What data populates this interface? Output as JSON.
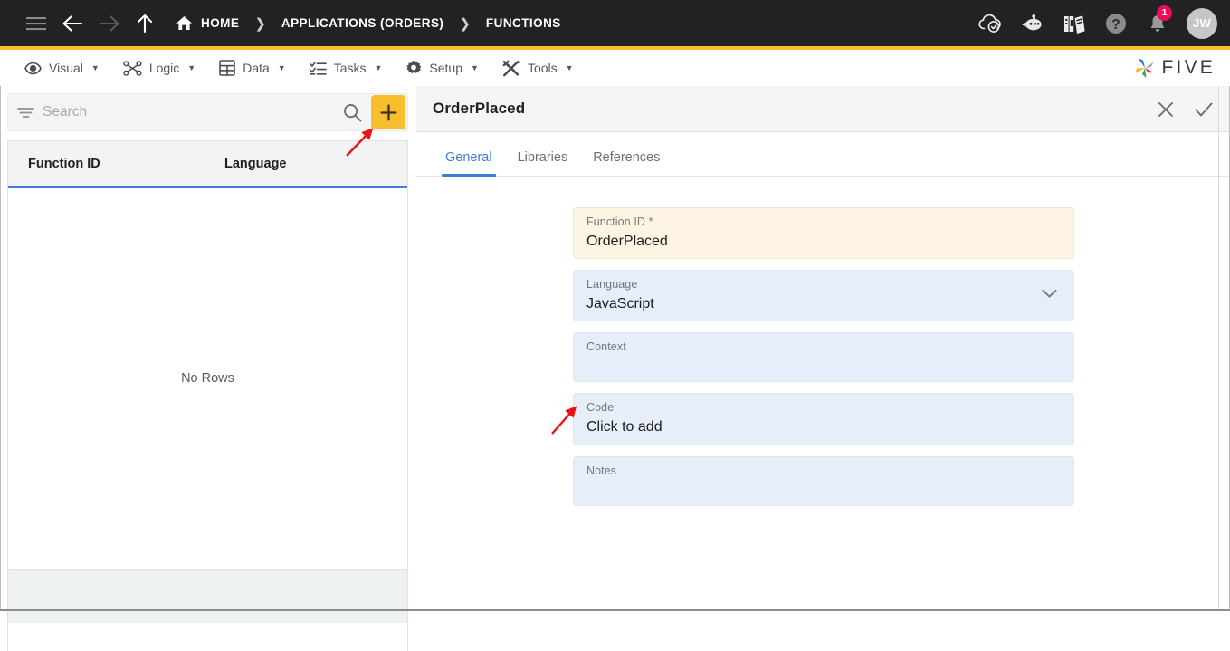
{
  "topbar": {
    "icons": {
      "menu": "hamburger-menu-icon",
      "back": "arrow-back-icon",
      "forward": "arrow-forward-icon",
      "up": "arrow-up-icon",
      "home": "home-icon"
    },
    "breadcrumb": [
      {
        "label": "HOME",
        "icon": "home-icon"
      },
      {
        "label": "APPLICATIONS (ORDERS)"
      },
      {
        "label": "FUNCTIONS"
      }
    ],
    "separator": "❯",
    "right_icons": [
      {
        "name": "cloud-check-icon",
        "label": ""
      },
      {
        "name": "chatbot-icon",
        "label": ""
      },
      {
        "name": "books-icon",
        "label": ""
      },
      {
        "name": "help-icon",
        "label": ""
      },
      {
        "name": "notification-bell-icon",
        "label": ""
      }
    ],
    "notification_count": "1",
    "avatar_initials": "JW",
    "accent_color": "#F9BE2C",
    "bg_color": "#222222",
    "badge_color": "#EC0B5C"
  },
  "menubar": {
    "items": [
      {
        "label": "Visual",
        "icon": "eye-icon",
        "caret": "▼"
      },
      {
        "label": "Logic",
        "icon": "logic-nodes-icon",
        "caret": "▼"
      },
      {
        "label": "Data",
        "icon": "grid-table-icon",
        "caret": "▼"
      },
      {
        "label": "Tasks",
        "icon": "checklist-icon",
        "caret": "▼"
      },
      {
        "label": "Setup",
        "icon": "gear-icon",
        "caret": "▼"
      },
      {
        "label": "Tools",
        "icon": "tools-wrench-screwdriver-icon",
        "caret": "▼"
      }
    ],
    "logo_text": "FIVE",
    "logo_icon": "five-pinwheel-logo-icon"
  },
  "list_panel": {
    "search": {
      "placeholder": "Search",
      "value": "",
      "filter_icon": "filter-icon",
      "search_icon": "search-icon"
    },
    "add_button": {
      "label": "+",
      "icon": "plus-icon",
      "color": "#F6BE2C"
    },
    "grid": {
      "columns": [
        "Function ID",
        "Language"
      ],
      "rows": [],
      "empty_text": "No Rows",
      "header_underline_color": "#3D7FD4"
    }
  },
  "detail_panel": {
    "title": "OrderPlaced",
    "actions": [
      {
        "name": "close-button",
        "icon": "close-x-icon"
      },
      {
        "name": "confirm-button",
        "icon": "check-icon"
      }
    ],
    "tabs": [
      {
        "label": "General",
        "active": true
      },
      {
        "label": "Libraries",
        "active": false
      },
      {
        "label": "References",
        "active": false
      }
    ],
    "active_tab_color": "#3B7FD4",
    "fields": [
      {
        "label": "Function ID *",
        "value": "OrderPlaced",
        "style": "cream",
        "type": "text",
        "name": "function-id-field"
      },
      {
        "label": "Language",
        "value": "JavaScript",
        "style": "blue",
        "type": "select",
        "name": "language-select",
        "chevron": "chevron-down-icon"
      },
      {
        "label": "Context",
        "value": "",
        "style": "blue",
        "type": "text",
        "name": "context-field"
      },
      {
        "label": "Code",
        "value": "Click to add",
        "style": "blue",
        "type": "text",
        "name": "code-field"
      },
      {
        "label": "Notes",
        "value": "",
        "style": "blue",
        "type": "text",
        "name": "notes-field"
      }
    ]
  },
  "annotations": {
    "color": "#EE1111",
    "arrows": [
      {
        "name": "arrow-to-add-button",
        "target": "add-button"
      },
      {
        "name": "arrow-to-code-field",
        "target": "code-field"
      }
    ]
  }
}
